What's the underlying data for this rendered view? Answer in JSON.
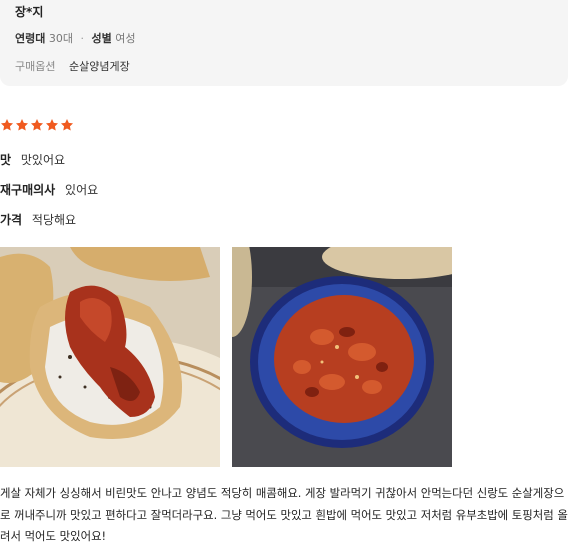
{
  "reviewer": {
    "name": "장*지",
    "age_label": "연령대",
    "age_value": "30대",
    "gender_label": "성별",
    "gender_value": "여성",
    "option_label": "구매옵션",
    "option_value": "순살양념게장"
  },
  "rating": {
    "stars": 5,
    "max": 5,
    "color": "#f05a1f"
  },
  "attributes": [
    {
      "label": "맛",
      "value": "맛있어요"
    },
    {
      "label": "재구매의사",
      "value": "있어요"
    },
    {
      "label": "가격",
      "value": "적당해요"
    }
  ],
  "photos": [
    {
      "icon": "food-photo-sushi"
    },
    {
      "icon": "food-photo-sauce-bowl"
    }
  ],
  "review_text": "게살 자체가 싱싱해서 비린맛도 안나고 양념도 적당히 매콤해요. 게장 발라먹기 귀찮아서 안먹는다던 신랑도 순살게장으로 꺼내주니까 맛있고 편하다고 잘먹더라구요. 그냥 먹어도 맛있고 흰밥에 먹어도 맛있고 저처럼 유부초밥에 토핑처럼 올려서 먹어도 맛있어요!"
}
